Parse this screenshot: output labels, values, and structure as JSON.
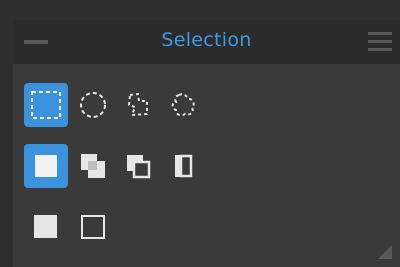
{
  "panel": {
    "title": "Selection",
    "header_icons": [
      "collapse-icon",
      "menu-icon"
    ]
  },
  "shape_tools": [
    {
      "name": "rectangle-selection-icon",
      "selected": true
    },
    {
      "name": "ellipse-selection-icon",
      "selected": false
    },
    {
      "name": "lasso-selection-icon",
      "selected": false
    },
    {
      "name": "freehand-selection-icon",
      "selected": false
    }
  ],
  "mode_tools": [
    {
      "name": "new-selection-mode-icon",
      "selected": true
    },
    {
      "name": "add-selection-mode-icon",
      "selected": false
    },
    {
      "name": "subtract-selection-mode-icon",
      "selected": false
    },
    {
      "name": "intersect-selection-mode-icon",
      "selected": false
    }
  ],
  "fill_tools": [
    {
      "name": "filled-square-icon",
      "selected": false
    },
    {
      "name": "outline-square-icon",
      "selected": false
    }
  ],
  "colors": {
    "accent": "#3a93dc",
    "title": "#3f9be2",
    "panel_bg": "#3a3a3a",
    "header_bg": "#2b2b2b",
    "icon": "#e6e6e6"
  }
}
